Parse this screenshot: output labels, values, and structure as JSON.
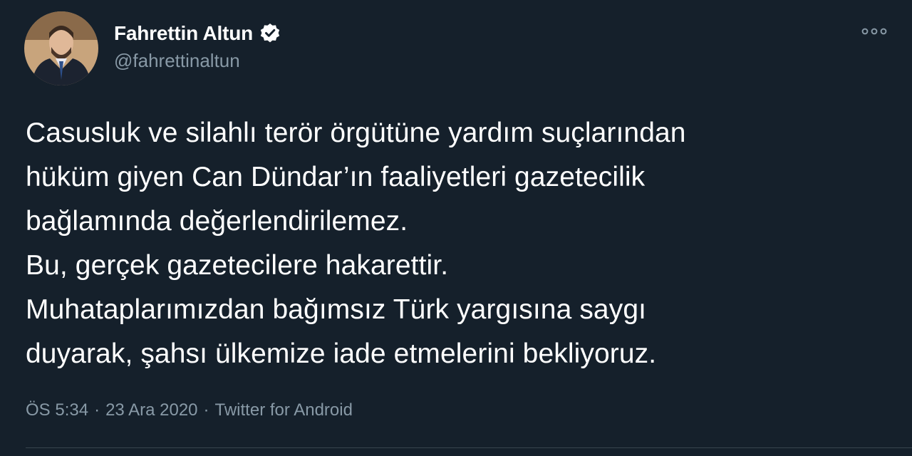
{
  "author": {
    "display_name": "Fahrettin Altun",
    "handle": "@fahrettinaltun",
    "verified": true,
    "avatar": "profile-photo"
  },
  "tweet": {
    "lines": [
      "Casusluk ve silahlı terör örgütüne yardım suçlarından",
      "hüküm giyen Can Dündar’ın faaliyetleri gazetecilik",
      "bağlamında değerlendirilemez.",
      "Bu, gerçek gazetecilere hakarettir.",
      "Muhataplarımızdan bağımsız Türk yargısına saygı",
      "duyarak, şahsı ülkemize iade etmelerini bekliyoruz."
    ]
  },
  "meta": {
    "time": "ÖS 5:34",
    "date": "23 Ara 2020",
    "source": "Twitter for Android",
    "separator": "·"
  },
  "icons": {
    "verified": "verified-badge-icon",
    "more": "more-options-icon"
  },
  "colors": {
    "background": "#15202b",
    "primary_text": "#ffffff",
    "secondary_text": "#8899a6",
    "divider": "#38444d"
  }
}
